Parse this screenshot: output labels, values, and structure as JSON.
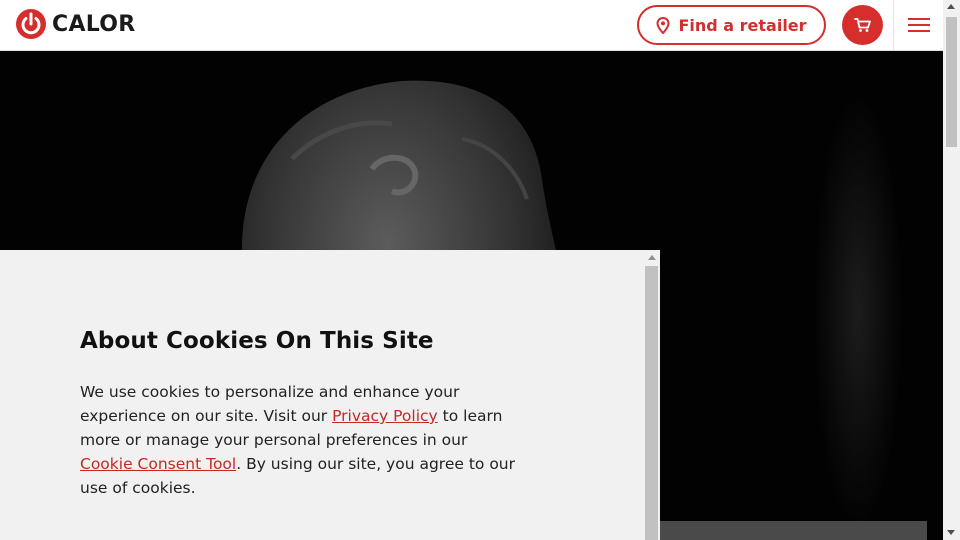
{
  "header": {
    "logo_text": "CALOR",
    "find_retailer_label": "Find a retailer",
    "cart_icon": "cart-icon",
    "menu_icon": "hamburger-menu-icon"
  },
  "cookie_banner": {
    "title": "About Cookies On This Site",
    "body_part1": "We use cookies to personalize and enhance your experience on our site. Visit our ",
    "privacy_link": "Privacy Policy",
    "body_part2": " to learn more or manage your personal preferences in our ",
    "consent_link": "Cookie Consent Tool",
    "body_part3": ". By using our site, you agree to our use of cookies."
  },
  "colors": {
    "brand_red": "#d62d2d",
    "banner_bg": "#f1f1f1",
    "link_red": "#c62828"
  }
}
